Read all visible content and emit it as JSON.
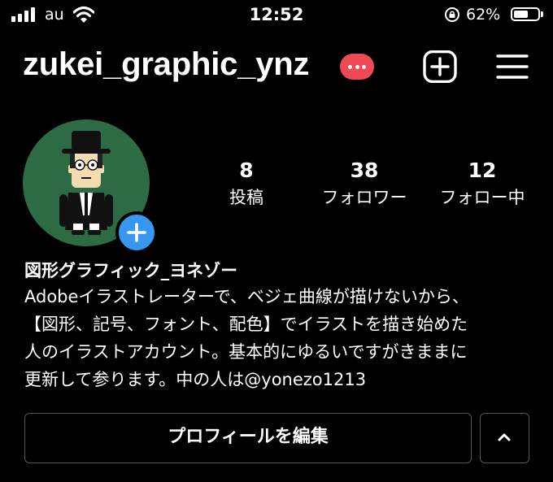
{
  "status_bar": {
    "carrier": "au",
    "time": "12:52",
    "battery_percent": "62%",
    "battery_level": 0.62,
    "icons": [
      "signal-icon",
      "wifi-icon",
      "orientation-lock-icon",
      "battery-icon"
    ]
  },
  "header": {
    "username": "zukei_graphic_ynz",
    "icons": [
      "more-badge-icon",
      "add-post-icon",
      "menu-icon"
    ]
  },
  "profile": {
    "avatar_icon": "avatar-add-icon",
    "stats": [
      {
        "value": "8",
        "label": "投稿"
      },
      {
        "value": "38",
        "label": "フォロワー"
      },
      {
        "value": "12",
        "label": "フォロー中"
      }
    ],
    "full_name": "図形グラフィック_ヨネゾー",
    "bio_lines": [
      "Adobeイラストレーターで、ベジェ曲線が描けないから、",
      "【図形、記号、フォント、配色】でイラストを描き始めた",
      "人のイラストアカウント。基本的にゆるいですがきままに",
      "更新して参ります。中の人は@yonezo1213"
    ]
  },
  "actions": {
    "edit_profile_label": "プロフィールを編集",
    "expand_icon": "chevron-up-icon"
  },
  "colors": {
    "background": "#000000",
    "badge": "#ed4956",
    "avatar_bg": "#2d6b45",
    "add_blue": "#3797f0"
  }
}
